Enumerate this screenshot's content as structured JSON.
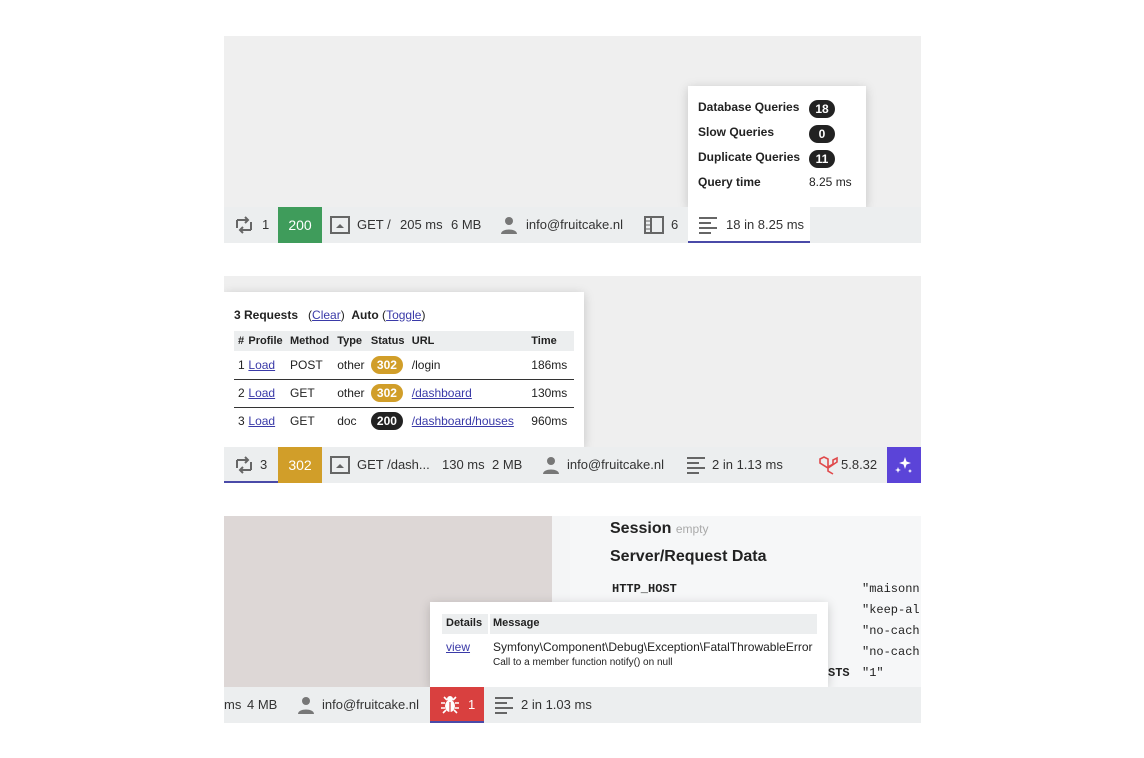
{
  "panel1": {
    "bar": {
      "requests_count": "1",
      "status_code": "200",
      "route": "GET /",
      "duration": "205 ms",
      "memory": "6 MB",
      "user": "info@fruitcake.nl",
      "views_count": "6",
      "queries_summary": "18 in 8.25 ms"
    },
    "tooltip": {
      "rows": [
        {
          "label": "Database Queries",
          "value": "18",
          "badge": true
        },
        {
          "label": "Slow Queries",
          "value": "0",
          "badge": true
        },
        {
          "label": "Duplicate Queries",
          "value": "11",
          "badge": true
        },
        {
          "label": "Query time",
          "value": "8.25 ms",
          "badge": false
        }
      ]
    }
  },
  "panel2": {
    "history": {
      "title": "3 Requests",
      "clear_label": "Clear",
      "auto_label": "Auto",
      "toggle_label": "Toggle",
      "columns": [
        "#",
        "Profile",
        "Method",
        "Type",
        "Status",
        "URL",
        "Time"
      ],
      "rows": [
        {
          "num": "1",
          "profile": "Load",
          "method": "POST",
          "type": "other",
          "status": "302",
          "url": "/login",
          "time": "186ms"
        },
        {
          "num": "2",
          "profile": "Load",
          "method": "GET",
          "type": "other",
          "status": "302",
          "url": "/dashboard",
          "time": "130ms"
        },
        {
          "num": "3",
          "profile": "Load",
          "method": "GET",
          "type": "doc",
          "status": "200",
          "url": "/dashboard/houses",
          "time": "960ms"
        }
      ]
    },
    "bar": {
      "requests_count": "3",
      "status_code": "302",
      "route": "GET /dash...",
      "duration": "130 ms",
      "memory": "2 MB",
      "user": "info@fruitcake.nl",
      "queries_summary": "2 in 1.13 ms",
      "laravel_version": "5.8.32"
    }
  },
  "panel3": {
    "session_title": "Session",
    "session_empty": "empty",
    "server_title": "Server/Request Data",
    "server_rows": [
      {
        "key": "HTTP_HOST",
        "value": "\"maisonn"
      },
      {
        "key": "",
        "value": "\"keep-al"
      },
      {
        "key": "",
        "value": "\"no-cach"
      },
      {
        "key": "",
        "value": "\"no-cach"
      },
      {
        "key": "STS",
        "value": "\"1\""
      }
    ],
    "exceptions": {
      "col_details": "Details",
      "col_message": "Message",
      "view_label": "view",
      "message_class": "Symfony\\Component\\Debug\\Exception\\FatalThrowableError",
      "message_detail": "Call to a member function notify() on null"
    },
    "bar": {
      "duration_partial": "ms",
      "memory": "4 MB",
      "user": "info@fruitcake.nl",
      "exceptions_count": "1",
      "queries_summary": "2 in 1.03 ms"
    }
  },
  "colors": {
    "status_ok": "#3f9c5b",
    "status_redirect": "#d19e29",
    "exception_red": "#d9403f",
    "clockwork_purple": "#5b44d8",
    "active_underline": "#4a4aa8",
    "bar_bg": "#eceeef"
  },
  "icons": [
    "requests-icon",
    "route-icon",
    "user-icon",
    "views-icon",
    "queries-icon",
    "laravel-icon",
    "clockwork-icon",
    "bug-icon"
  ]
}
